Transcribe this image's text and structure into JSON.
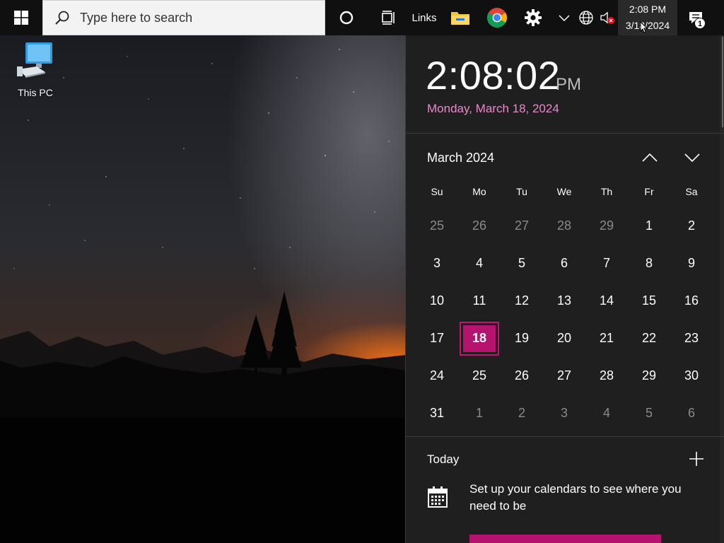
{
  "taskbar": {
    "search": {
      "placeholder": "Type here to search"
    },
    "links_label": "Links",
    "clock": {
      "time": "2:08 PM",
      "date": "3/18/2024"
    },
    "notification_count": "1"
  },
  "desktop": {
    "icons": [
      {
        "label": "This PC",
        "icon": "computer-icon"
      }
    ]
  },
  "flyout": {
    "time": "2:08:02",
    "ampm": "PM",
    "long_date": "Monday, March 18, 2024",
    "month_title": "March 2024",
    "weekdays": [
      "Su",
      "Mo",
      "Tu",
      "We",
      "Th",
      "Fr",
      "Sa"
    ],
    "weeks": [
      [
        "25",
        "26",
        "27",
        "28",
        "29",
        "1",
        "2"
      ],
      [
        "3",
        "4",
        "5",
        "6",
        "7",
        "8",
        "9"
      ],
      [
        "10",
        "11",
        "12",
        "13",
        "14",
        "15",
        "16"
      ],
      [
        "17",
        "18",
        "19",
        "20",
        "21",
        "22",
        "23"
      ],
      [
        "24",
        "25",
        "26",
        "27",
        "28",
        "29",
        "30"
      ],
      [
        "31",
        "1",
        "2",
        "3",
        "4",
        "5",
        "6"
      ]
    ],
    "other_month_mask": [
      [
        true,
        true,
        true,
        true,
        true,
        false,
        false
      ],
      [
        false,
        false,
        false,
        false,
        false,
        false,
        false
      ],
      [
        false,
        false,
        false,
        false,
        false,
        false,
        false
      ],
      [
        false,
        false,
        false,
        false,
        false,
        false,
        false
      ],
      [
        false,
        false,
        false,
        false,
        false,
        false,
        false
      ],
      [
        false,
        true,
        true,
        true,
        true,
        true,
        true
      ]
    ],
    "selected_day": "18",
    "agenda": {
      "today_label": "Today",
      "setup_text": "Set up your calendars to see where you need to be"
    }
  },
  "colors": {
    "accent": "#b5136e",
    "date_text": "#e98ac9",
    "flyout_bg": "#1f1f1f"
  }
}
